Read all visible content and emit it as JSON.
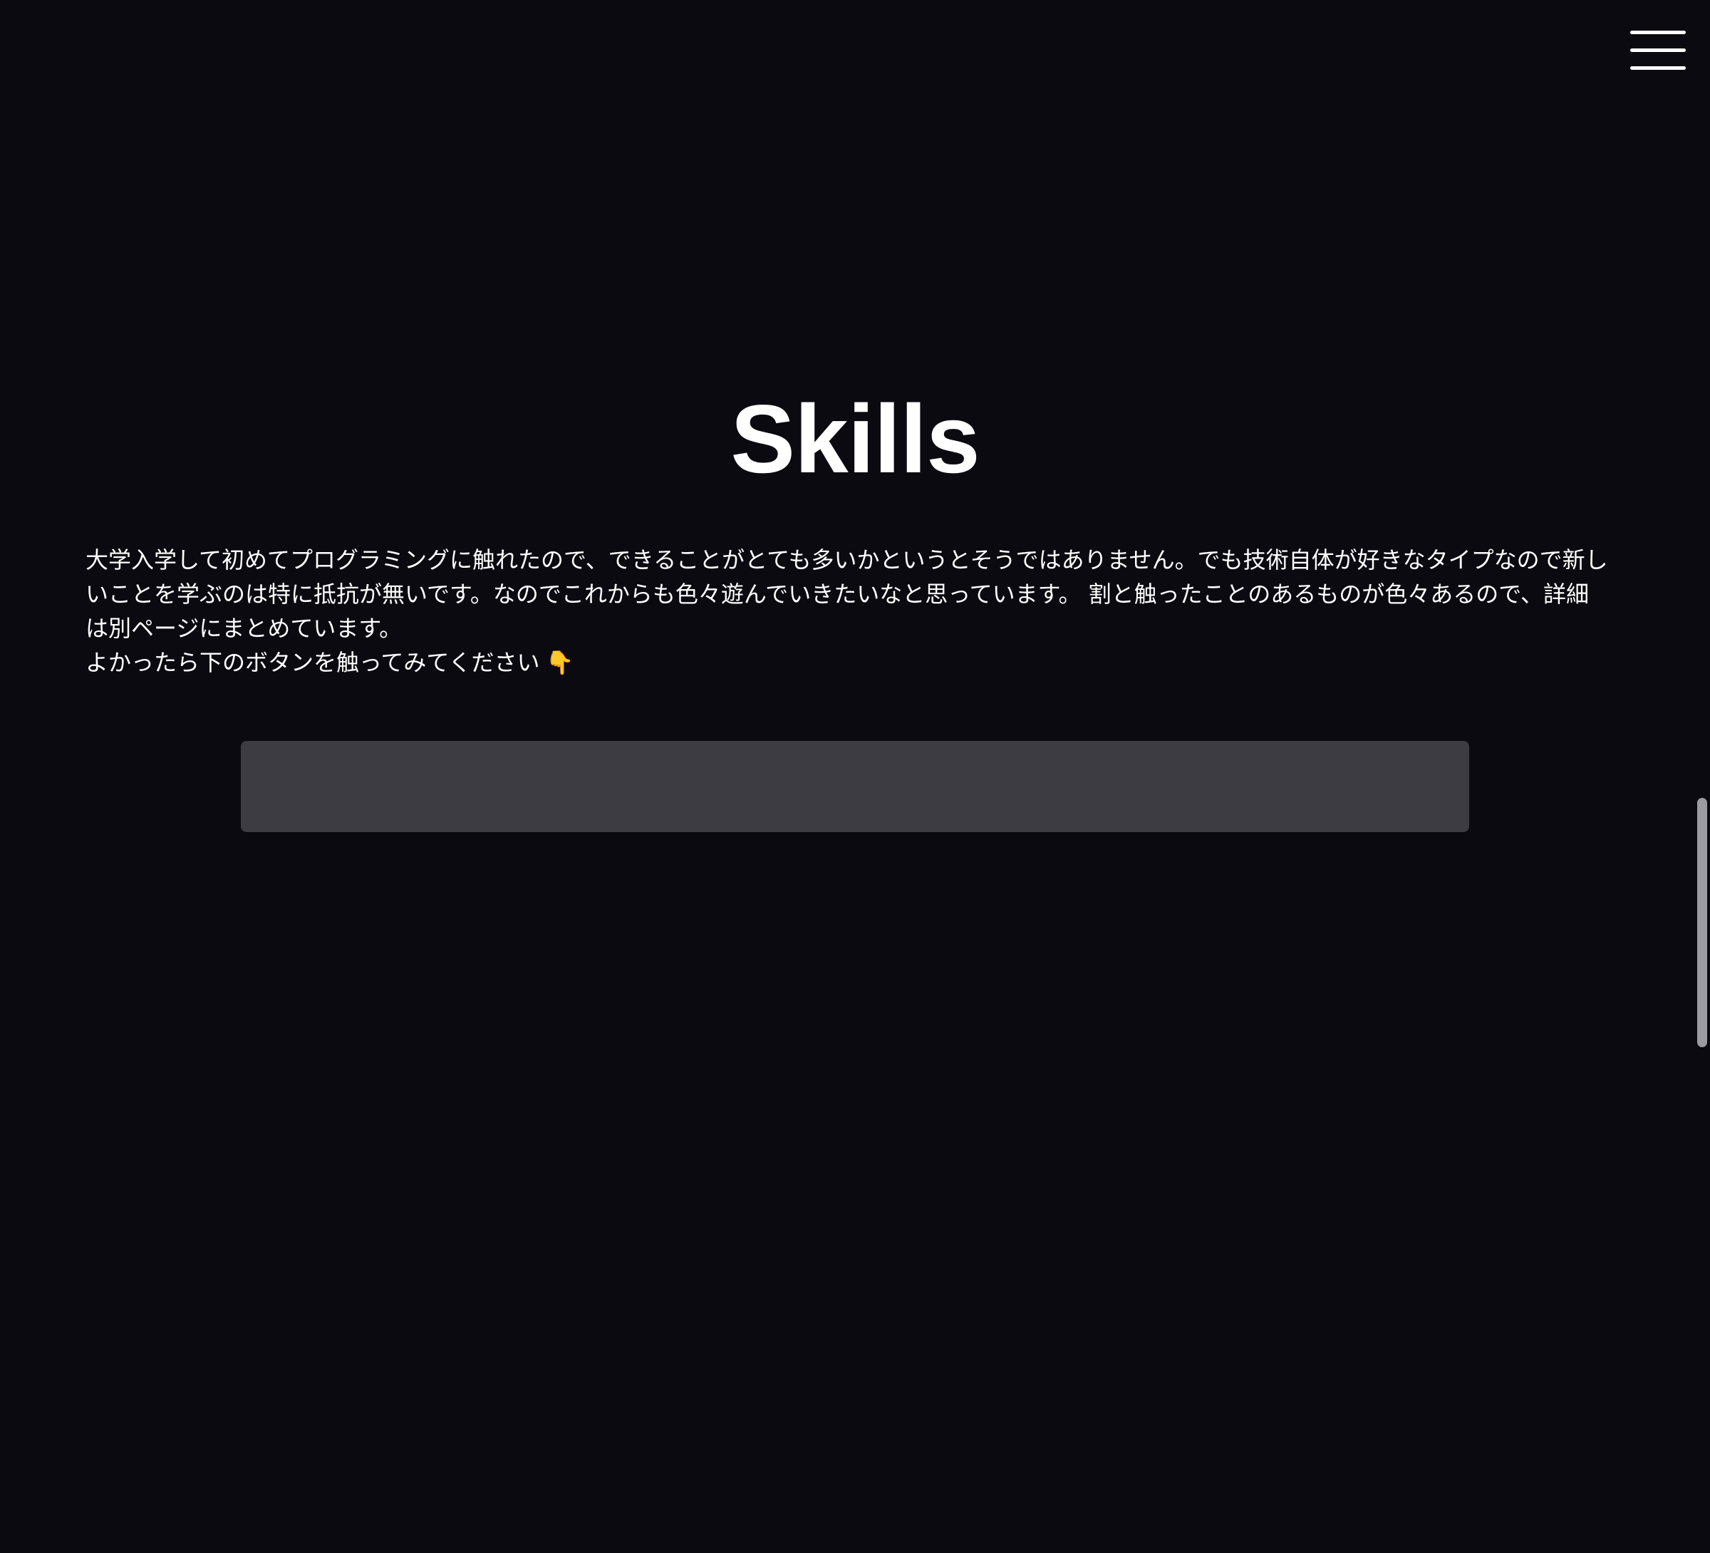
{
  "nav": {
    "menu_icon": "hamburger-menu-icon"
  },
  "skills": {
    "title": "Skills",
    "paragraph1": "大学入学して初めてプログラミングに触れたので、できることがとても多いかというとそうではありません。でも技術自体が好きなタイプなので新しいことを学ぶのは特に抵抗が無いです。なのでこれからも色々遊んでいきたいなと思っています。 割と触ったことのあるものが色々あるので、詳細は別ページにまとめています。",
    "paragraph2": "よかったら下のボタンを触ってみてください",
    "pointing_icon": "👇",
    "button_label": ""
  },
  "colors": {
    "background": "#0a0a10",
    "text": "#ffffff",
    "button": "#3d3c42",
    "scrollbar": "#9c9ca0"
  }
}
